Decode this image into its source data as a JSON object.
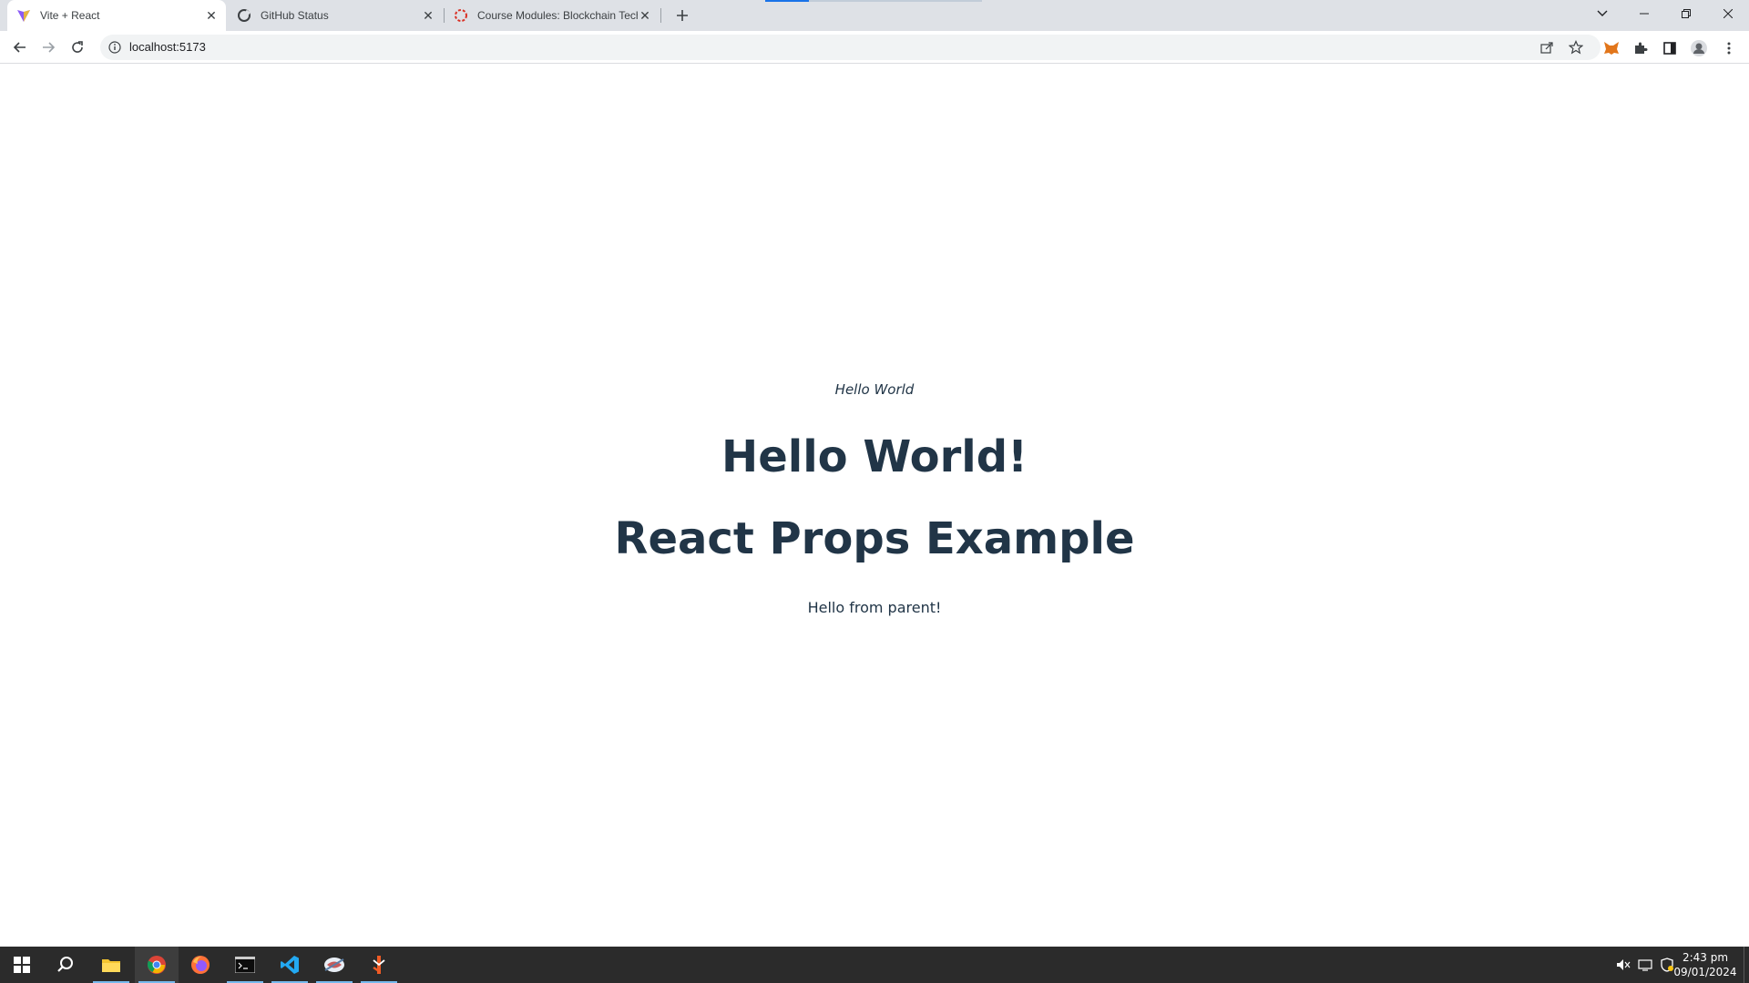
{
  "browser": {
    "tabs": [
      {
        "title": "Vite + React",
        "icon": "vite-icon",
        "active": true
      },
      {
        "title": "GitHub Status",
        "icon": "github-status-icon",
        "active": false
      },
      {
        "title": "Course Modules: Blockchain Tech",
        "icon": "course-icon",
        "active": false
      }
    ],
    "address": "localhost:5173"
  },
  "page": {
    "tagline": "Hello World",
    "heading": "Hello World!",
    "subheading": "React Props Example",
    "message": "Hello from parent!"
  },
  "taskbar": {
    "apps": [
      {
        "name": "start-icon"
      },
      {
        "name": "search-icon"
      },
      {
        "name": "file-explorer-icon"
      },
      {
        "name": "chrome-icon"
      },
      {
        "name": "firefox-icon"
      },
      {
        "name": "terminal-icon"
      },
      {
        "name": "vscode-icon"
      },
      {
        "name": "brain-app-icon"
      },
      {
        "name": "postman-icon"
      }
    ],
    "time": "2:43 pm",
    "date": "09/01/2024"
  },
  "colors": {
    "page_text": "#213547",
    "tabstrip_bg": "#dee1e6",
    "taskbar_bg": "#2b2b2b",
    "accent": "#1a73e8"
  }
}
